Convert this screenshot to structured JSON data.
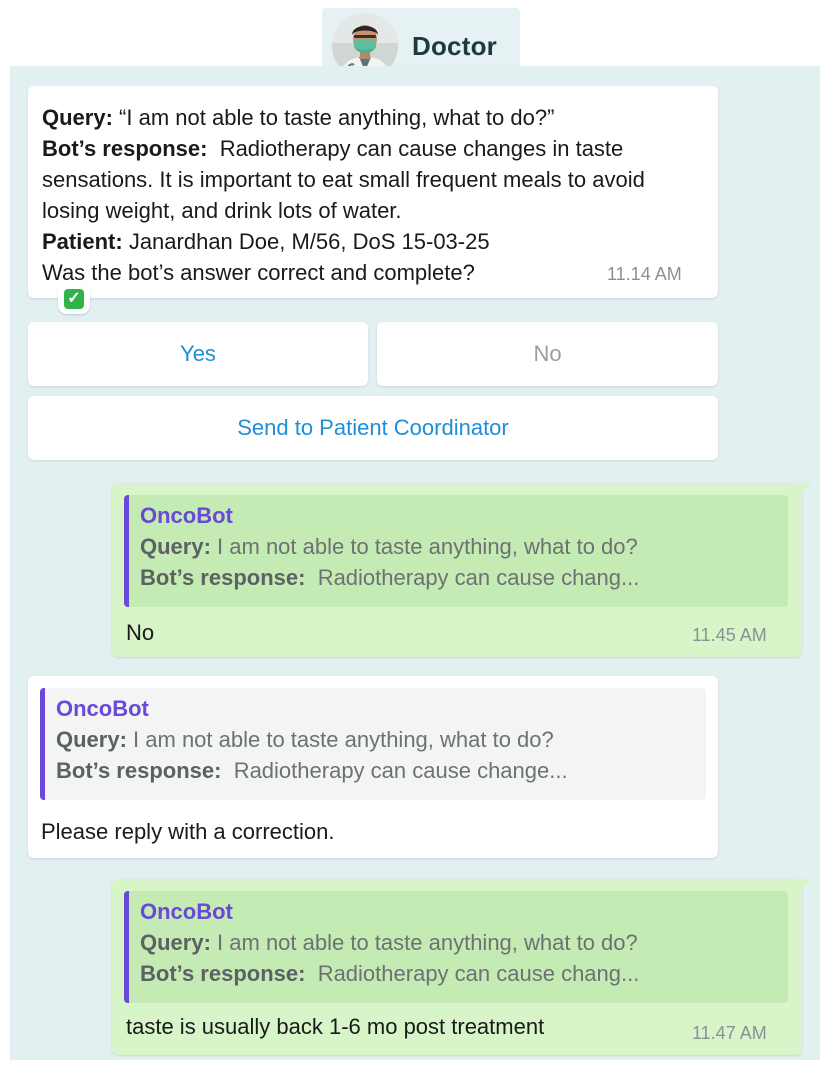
{
  "header": {
    "title": "Doctor",
    "avatar_icon": "doctor-avatar-icon"
  },
  "messages": {
    "bot_question": {
      "query_label": "Query:",
      "query_text": "“I am not able to taste anything, what to do?”",
      "response_label": "Bot’s response:",
      "response_text": "Radiotherapy can cause changes in taste sensations. It is important to eat small frequent meals to avoid losing weight, and drink lots of water.",
      "patient_label": "Patient:",
      "patient_text": "Janardhan Doe, M/56, DoS 15-03-25",
      "prompt": "Was the bot’s answer correct and complete?",
      "time": "11.14 AM",
      "reaction": "✓"
    },
    "buttons": {
      "yes": "Yes",
      "no": "No",
      "send": "Send to Patient Coordinator"
    },
    "reply_no": {
      "quote_title": "OncoBot",
      "quote_query_label": "Query:",
      "quote_query_text": "I am not able to taste anything, what to do?",
      "quote_response_label": "Bot’s response:",
      "quote_response_text": "Radiotherapy can cause chang...",
      "text": "No",
      "time": "11.45 AM"
    },
    "bot_correction": {
      "quote_title": "OncoBot",
      "quote_query_label": "Query:",
      "quote_query_text": "I am not able to taste anything, what to do?",
      "quote_response_label": "Bot’s response:",
      "quote_response_text": "Radiotherapy can cause change...",
      "text": "Please reply with a correction."
    },
    "reply_correction": {
      "quote_title": "OncoBot",
      "quote_query_label": "Query:",
      "quote_query_text": "I am not able to taste anything, what to do?",
      "quote_response_label": "Bot’s response:",
      "quote_response_text": "Radiotherapy can cause chang...",
      "text": "taste is usually back 1-6 mo post treatment",
      "time": "11.47 AM"
    }
  },
  "colors": {
    "accent_purple": "#6a48d8",
    "link_blue": "#1e8ed8",
    "outgoing_bg": "#d7f5c9",
    "chat_bg": "#e3f0f2"
  }
}
